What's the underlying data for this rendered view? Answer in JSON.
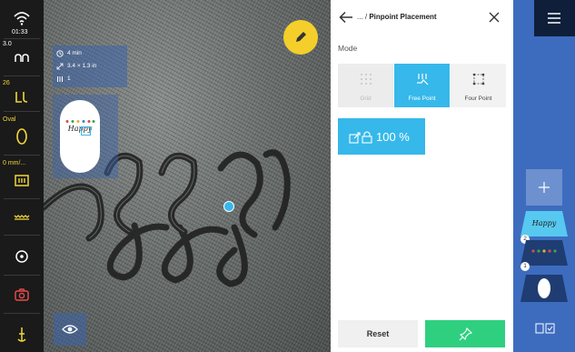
{
  "status": {
    "time": "01:33",
    "speed_value": "3.0",
    "tension_value": "26",
    "hoop_value": "Oval",
    "feed_value": "0 mm/..."
  },
  "canvas": {
    "info_time": "4 min",
    "info_size": "3.4 × 1.3 in",
    "info_colors": "1",
    "thumb_text": "Happy"
  },
  "panel": {
    "title_prefix": "... / ",
    "title": "Pinpoint Placement",
    "mode_label": "Mode",
    "modes": [
      {
        "label": "Grid",
        "state": "disabled"
      },
      {
        "label": "Free Point",
        "state": "selected"
      },
      {
        "label": "Four Point",
        "state": "normal"
      }
    ],
    "scale_value": "100 %",
    "reset_label": "Reset"
  },
  "layers": {
    "badge_2": "2",
    "badge_1": "1",
    "layer1_text": "Happy"
  },
  "colors": {
    "accent_blue": "#36b8ea",
    "apply_green": "#2fcf80",
    "fab_yellow": "#f4cf2b",
    "sidebar_blue": "#3d6cbf",
    "status_yellow": "#f1d53a"
  }
}
